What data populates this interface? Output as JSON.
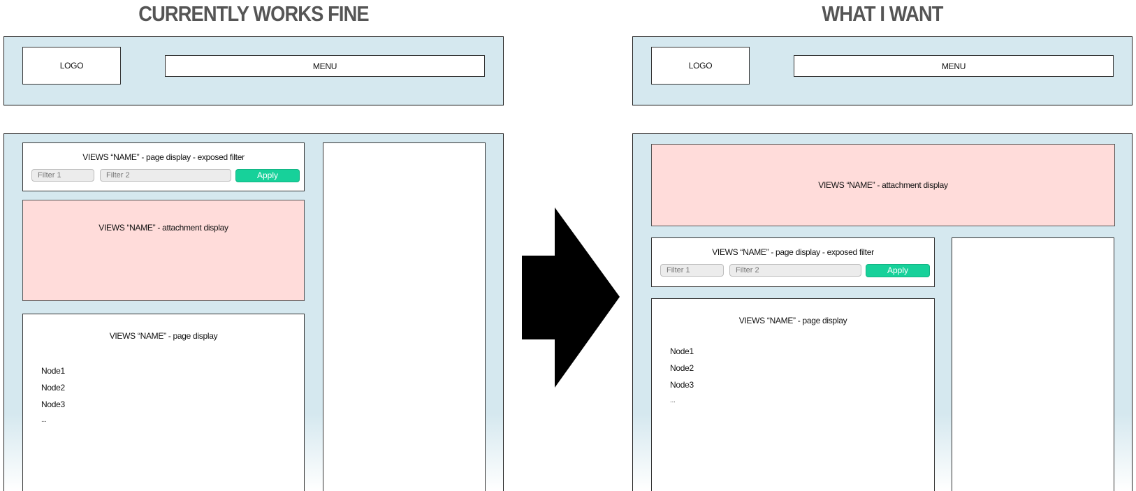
{
  "headings": {
    "current": "CURRENTLY WORKS FINE",
    "desired": "WHAT I WANT"
  },
  "wireframe": {
    "logo_label": "LOGO",
    "menu_label": "MENU",
    "exposed_filter": {
      "title": "VIEWS “NAME” - page display - exposed filter",
      "filter1_placeholder": "Filter 1",
      "filter2_placeholder": "Filter 2",
      "apply_label": "Apply"
    },
    "attachment_title": "VIEWS “NAME” - attachment display",
    "page_display": {
      "title": "VIEWS “NAME” - page display",
      "nodes": [
        "Node1",
        "Node2",
        "Node3",
        "..."
      ]
    }
  },
  "colors": {
    "frame_background": "#d5e8ef",
    "attachment_background": "#ffdcda",
    "apply_button": "#17d19a",
    "heading_text": "#555555"
  },
  "arrow": {
    "direction": "right",
    "icon": "arrow-right-icon"
  }
}
